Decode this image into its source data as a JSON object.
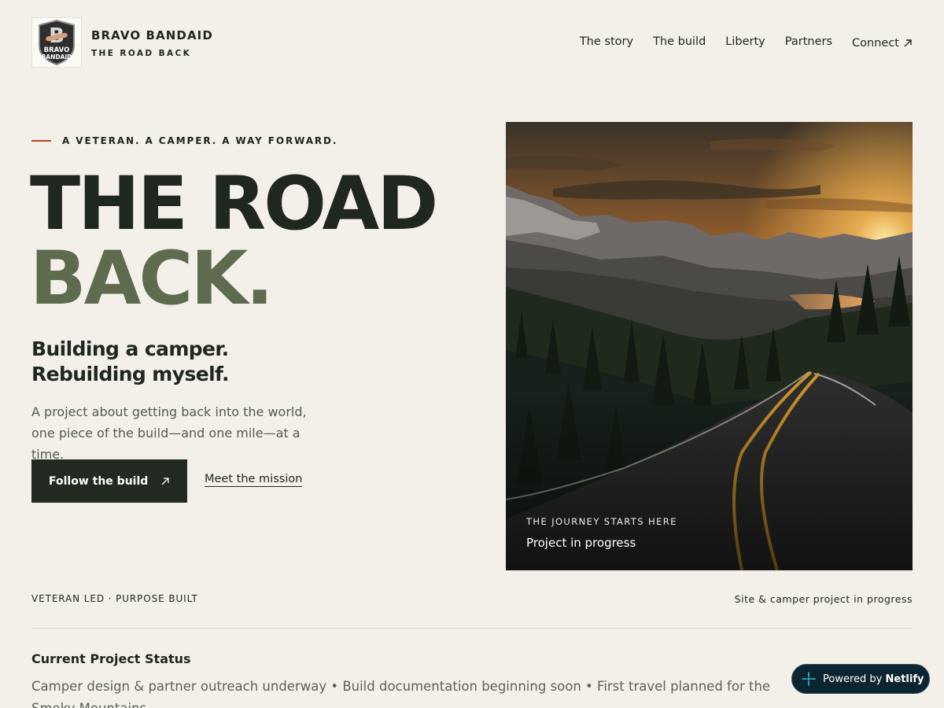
{
  "brand": {
    "name": "BRAVO BANDAID",
    "tagline": "THE ROAD BACK",
    "logo_letter": "B",
    "logo_top": "BRAVO",
    "logo_bottom": "BANDAID"
  },
  "nav": {
    "items": [
      "The story",
      "The build",
      "Liberty",
      "Partners"
    ],
    "connect_label": "Connect",
    "connect_icon": "arrow-up-right"
  },
  "hero": {
    "eyebrow": "A VETERAN. A CAMPER. A WAY FORWARD.",
    "headline_line1": "THE ROAD",
    "headline_line2": "BACK.",
    "subhead_line1": "Building a camper.",
    "subhead_line2": "Rebuilding myself.",
    "lede": "A project about getting back into the world, one piece of the build—and one mile—at a time.",
    "primary_cta": "Follow the build",
    "primary_cta_icon": "arrow-up-right",
    "secondary_cta": "Meet the mission",
    "image_kicker": "THE JOURNEY STARTS HERE",
    "image_status": "Project in progress"
  },
  "strip": {
    "left": "VETERAN LED · PURPOSE BUILT",
    "right": "Site & camper project in progress"
  },
  "status": {
    "title": "Current Project Status",
    "body": "Camper design & partner outreach underway • Build documentation beginning soon • First travel planned for the Smoky Mountains"
  },
  "badge": {
    "prefix": "Powered by",
    "brand": "Netlify"
  },
  "colors": {
    "background": "#f3f0ea",
    "ink": "#20271f",
    "olive": "#5f6b4e",
    "accent_rule": "#b24a2b",
    "button": "#232a22",
    "netlify_bg": "#0d2530"
  }
}
